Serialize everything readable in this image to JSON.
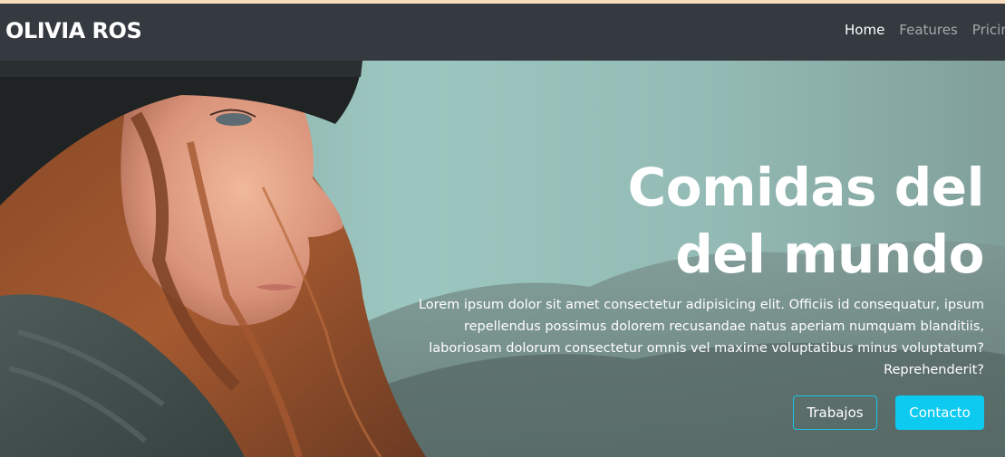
{
  "navbar": {
    "brand": "OLIVIA ROS",
    "links": [
      {
        "label": "Home",
        "active": true
      },
      {
        "label": "Features",
        "active": false
      },
      {
        "label": "Pricing",
        "active": false
      }
    ]
  },
  "hero": {
    "title_line1": "Comidas del",
    "title_line2": "del mundo",
    "text": "Lorem ipsum dolor sit amet consectetur adipisicing elit. Officiis id consequatur, ipsum repellendus possimus dolorem recusandae natus aperiam numquam blanditiis, laboriosam dolorum consectetur omnis vel maxime voluptatibus minus voluptatum? Reprehenderit?",
    "button_primary": "Trabajos",
    "button_secondary": "Contacto"
  },
  "colors": {
    "navbar_bg": "#343a40",
    "accent": "#0dcaf0"
  }
}
